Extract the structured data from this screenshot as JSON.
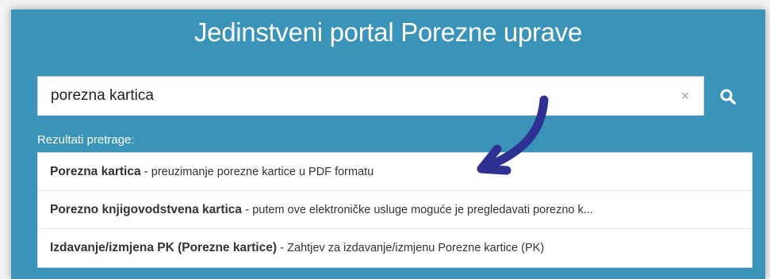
{
  "header": {
    "title": "Jedinstveni portal Porezne uprave"
  },
  "search": {
    "value": "porezna kartica",
    "clear_icon": "×",
    "button_icon": "search-icon"
  },
  "results": {
    "label": "Rezultati pretrage:",
    "sep": "-",
    "items": [
      {
        "title": "Porezna kartica",
        "description": "preuzimanje porezne kartice u PDF formatu"
      },
      {
        "title": "Porezno knjigovodstvena kartica",
        "description": "putem ove elektroničke usluge moguće je pregledavati porezno k..."
      },
      {
        "title": "Izdavanje/izmjena PK (Porezne kartice)",
        "description": "Zahtjev za izdavanje/izmjenu Porezne kartice (PK)"
      }
    ]
  },
  "colors": {
    "panel_background": "#3a93b8",
    "annotation_arrow": "#2e3192"
  }
}
